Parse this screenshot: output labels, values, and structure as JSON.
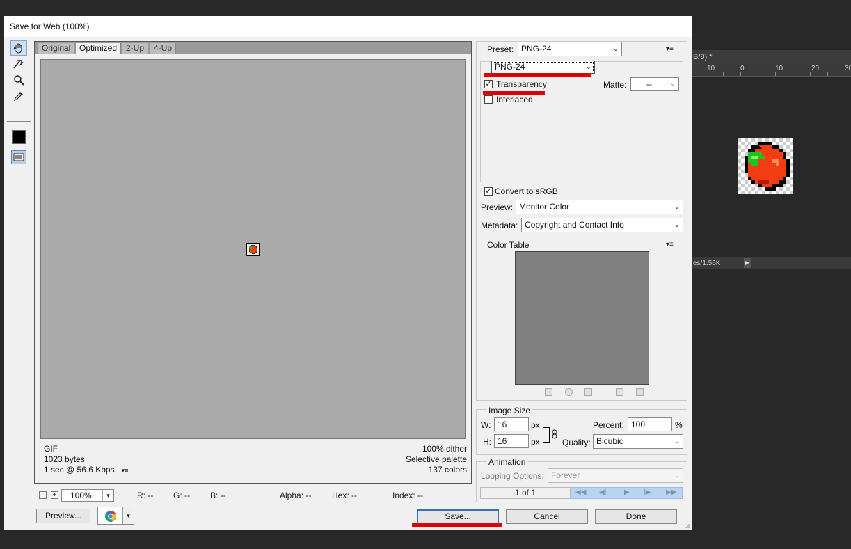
{
  "background": {
    "doc_tab": "B/8) *",
    "ruler_ticks": [
      "10",
      "0",
      "10",
      "20",
      "30"
    ],
    "status_text": "es/1.56K"
  },
  "dialog": {
    "title": "Save for Web (100%)",
    "view_tabs": [
      "Original",
      "Optimized",
      "2-Up",
      "4-Up"
    ],
    "active_tab": "Optimized",
    "info": {
      "format": "GIF",
      "size": "1023 bytes",
      "speed": "1 sec @ 56.6 Kbps",
      "dither": "100% dither",
      "palette": "Selective palette",
      "colors": "137 colors"
    },
    "zoom": "100%",
    "readout": {
      "r": "R: --",
      "g": "G: --",
      "b": "B: --",
      "alpha": "Alpha: --",
      "hex": "Hex: --",
      "index": "Index: --"
    },
    "buttons": {
      "preview": "Preview...",
      "save": "Save...",
      "cancel": "Cancel",
      "done": "Done"
    },
    "settings": {
      "preset_label": "Preset:",
      "preset_value": "PNG-24",
      "format_value": "PNG-24",
      "transparency_label": "Transparency",
      "transparency_checked": true,
      "interlaced_label": "Interlaced",
      "interlaced_checked": false,
      "matte_label": "Matte:",
      "matte_value": "--",
      "convert_label": "Convert to sRGB",
      "convert_checked": true,
      "preview_label": "Preview:",
      "preview_value": "Monitor Color",
      "metadata_label": "Metadata:",
      "metadata_value": "Copyright and Contact Info"
    },
    "color_table": {
      "title": "Color Table"
    },
    "image_size": {
      "title": "Image Size",
      "w_label": "W:",
      "w_value": "16",
      "h_label": "H:",
      "h_value": "16",
      "unit": "px",
      "percent_label": "Percent:",
      "percent_value": "100",
      "percent_unit": "%",
      "quality_label": "Quality:",
      "quality_value": "Bicubic"
    },
    "animation": {
      "title": "Animation",
      "looping_label": "Looping Options:",
      "looping_value": "Forever",
      "frame_count": "1 of 1"
    }
  },
  "colors": {
    "highlight_red": "#e00000",
    "canvas_gray": "#aaaaaa",
    "color_table_gray": "#808080"
  }
}
